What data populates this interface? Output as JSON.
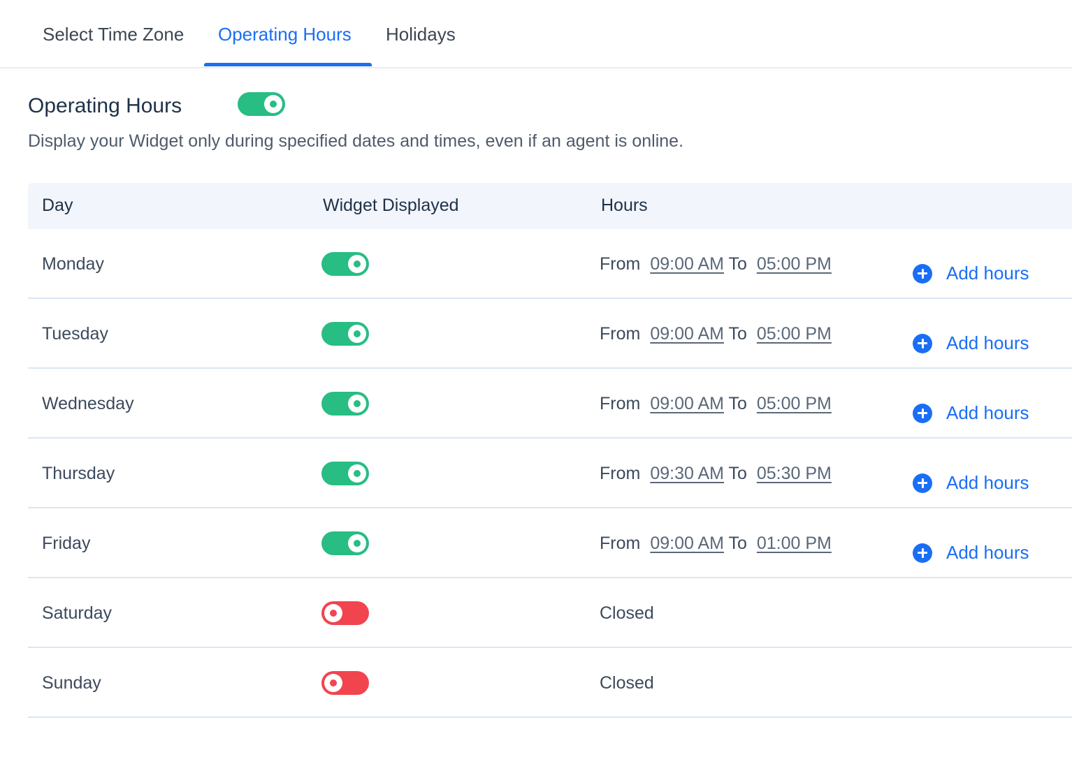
{
  "tabs": [
    {
      "label": "Select Time Zone",
      "active": false
    },
    {
      "label": "Operating Hours",
      "active": true
    },
    {
      "label": "Holidays",
      "active": false
    }
  ],
  "section": {
    "title": "Operating Hours",
    "enabled": true,
    "description": "Display your Widget only during specified dates and times, even if an agent is online."
  },
  "table": {
    "headers": {
      "day": "Day",
      "widget": "Widget Displayed",
      "hours": "Hours"
    },
    "from_label": "From",
    "to_label": "To",
    "add_label": "Add hours",
    "closed_label": "Closed",
    "rows": [
      {
        "day": "Monday",
        "displayed": true,
        "from": "09:00 AM",
        "to": "05:00 PM"
      },
      {
        "day": "Tuesday",
        "displayed": true,
        "from": "09:00 AM",
        "to": "05:00 PM"
      },
      {
        "day": "Wednesday",
        "displayed": true,
        "from": "09:00 AM",
        "to": "05:00 PM"
      },
      {
        "day": "Thursday",
        "displayed": true,
        "from": "09:30 AM",
        "to": "05:30 PM"
      },
      {
        "day": "Friday",
        "displayed": true,
        "from": "09:00 AM",
        "to": "01:00 PM"
      },
      {
        "day": "Saturday",
        "displayed": false,
        "status": "Closed"
      },
      {
        "day": "Sunday",
        "displayed": false,
        "status": "Closed"
      }
    ]
  },
  "colors": {
    "accent": "#1a6ef5",
    "toggle_on": "#27bd83",
    "toggle_off": "#f2444f",
    "header_bg": "#f2f6fc"
  }
}
